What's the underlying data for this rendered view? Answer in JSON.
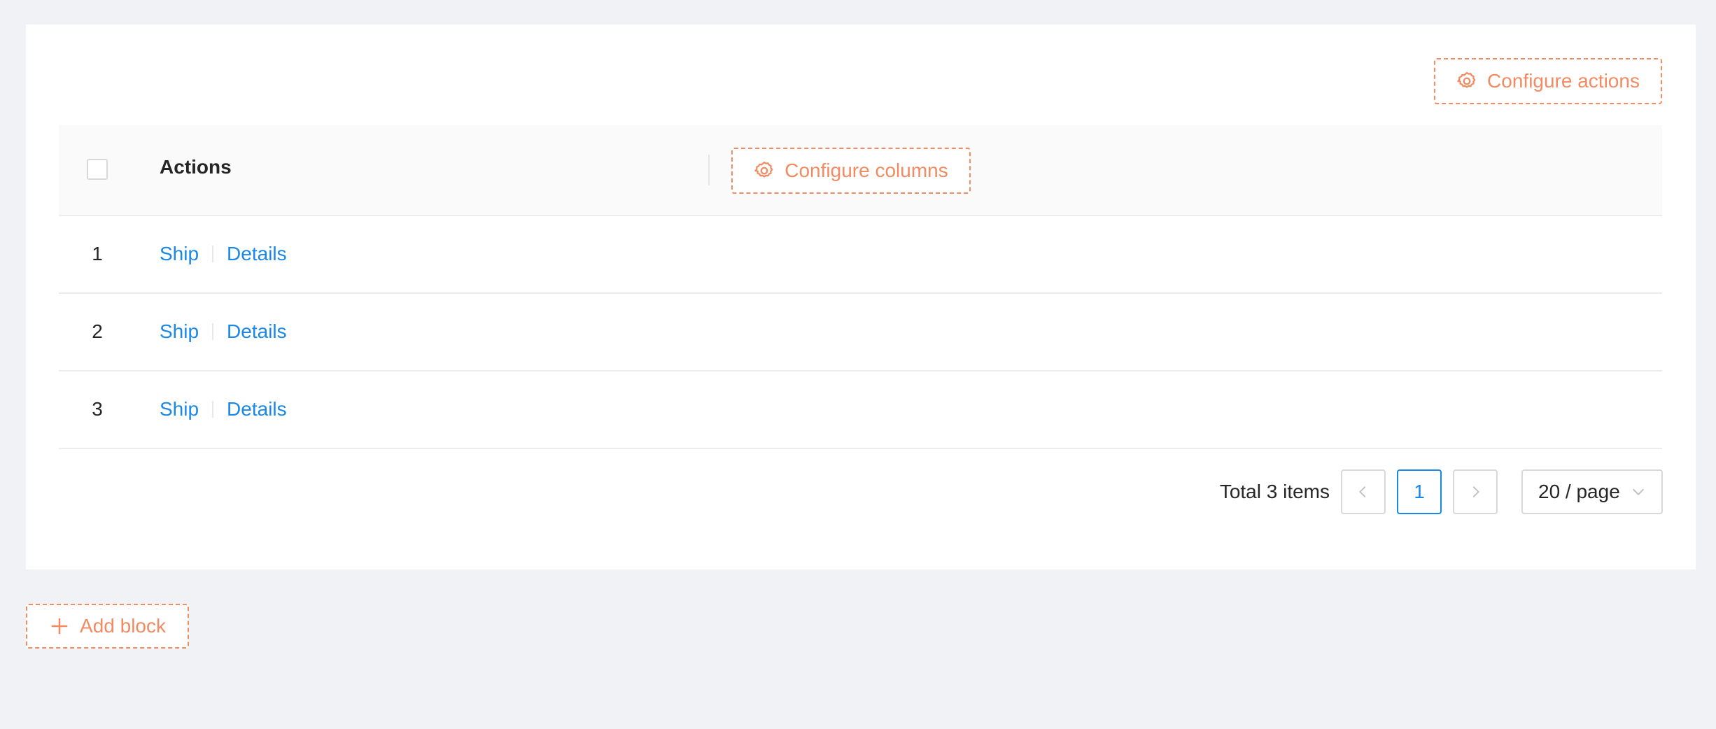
{
  "toolbar": {
    "configure_actions_label": "Configure actions"
  },
  "table": {
    "header": {
      "actions_label": "Actions",
      "configure_columns_label": "Configure columns"
    },
    "rows": [
      {
        "index": "1",
        "actions": [
          "Ship",
          "Details"
        ]
      },
      {
        "index": "2",
        "actions": [
          "Ship",
          "Details"
        ]
      },
      {
        "index": "3",
        "actions": [
          "Ship",
          "Details"
        ]
      }
    ]
  },
  "pagination": {
    "total_label": "Total 3 items",
    "current_page": "1",
    "page_size": "20 / page"
  },
  "add_block_label": "Add block",
  "colors": {
    "accent_dashed": "#f18b62",
    "link": "#1a88e8",
    "background": "#f0f2f5"
  },
  "icons": {
    "configure_actions": "gear-icon",
    "configure_columns": "gear-icon",
    "prev_page": "chevron-left-icon",
    "next_page": "chevron-right-icon",
    "page_size": "chevron-down-icon",
    "add_block": "plus-icon"
  }
}
